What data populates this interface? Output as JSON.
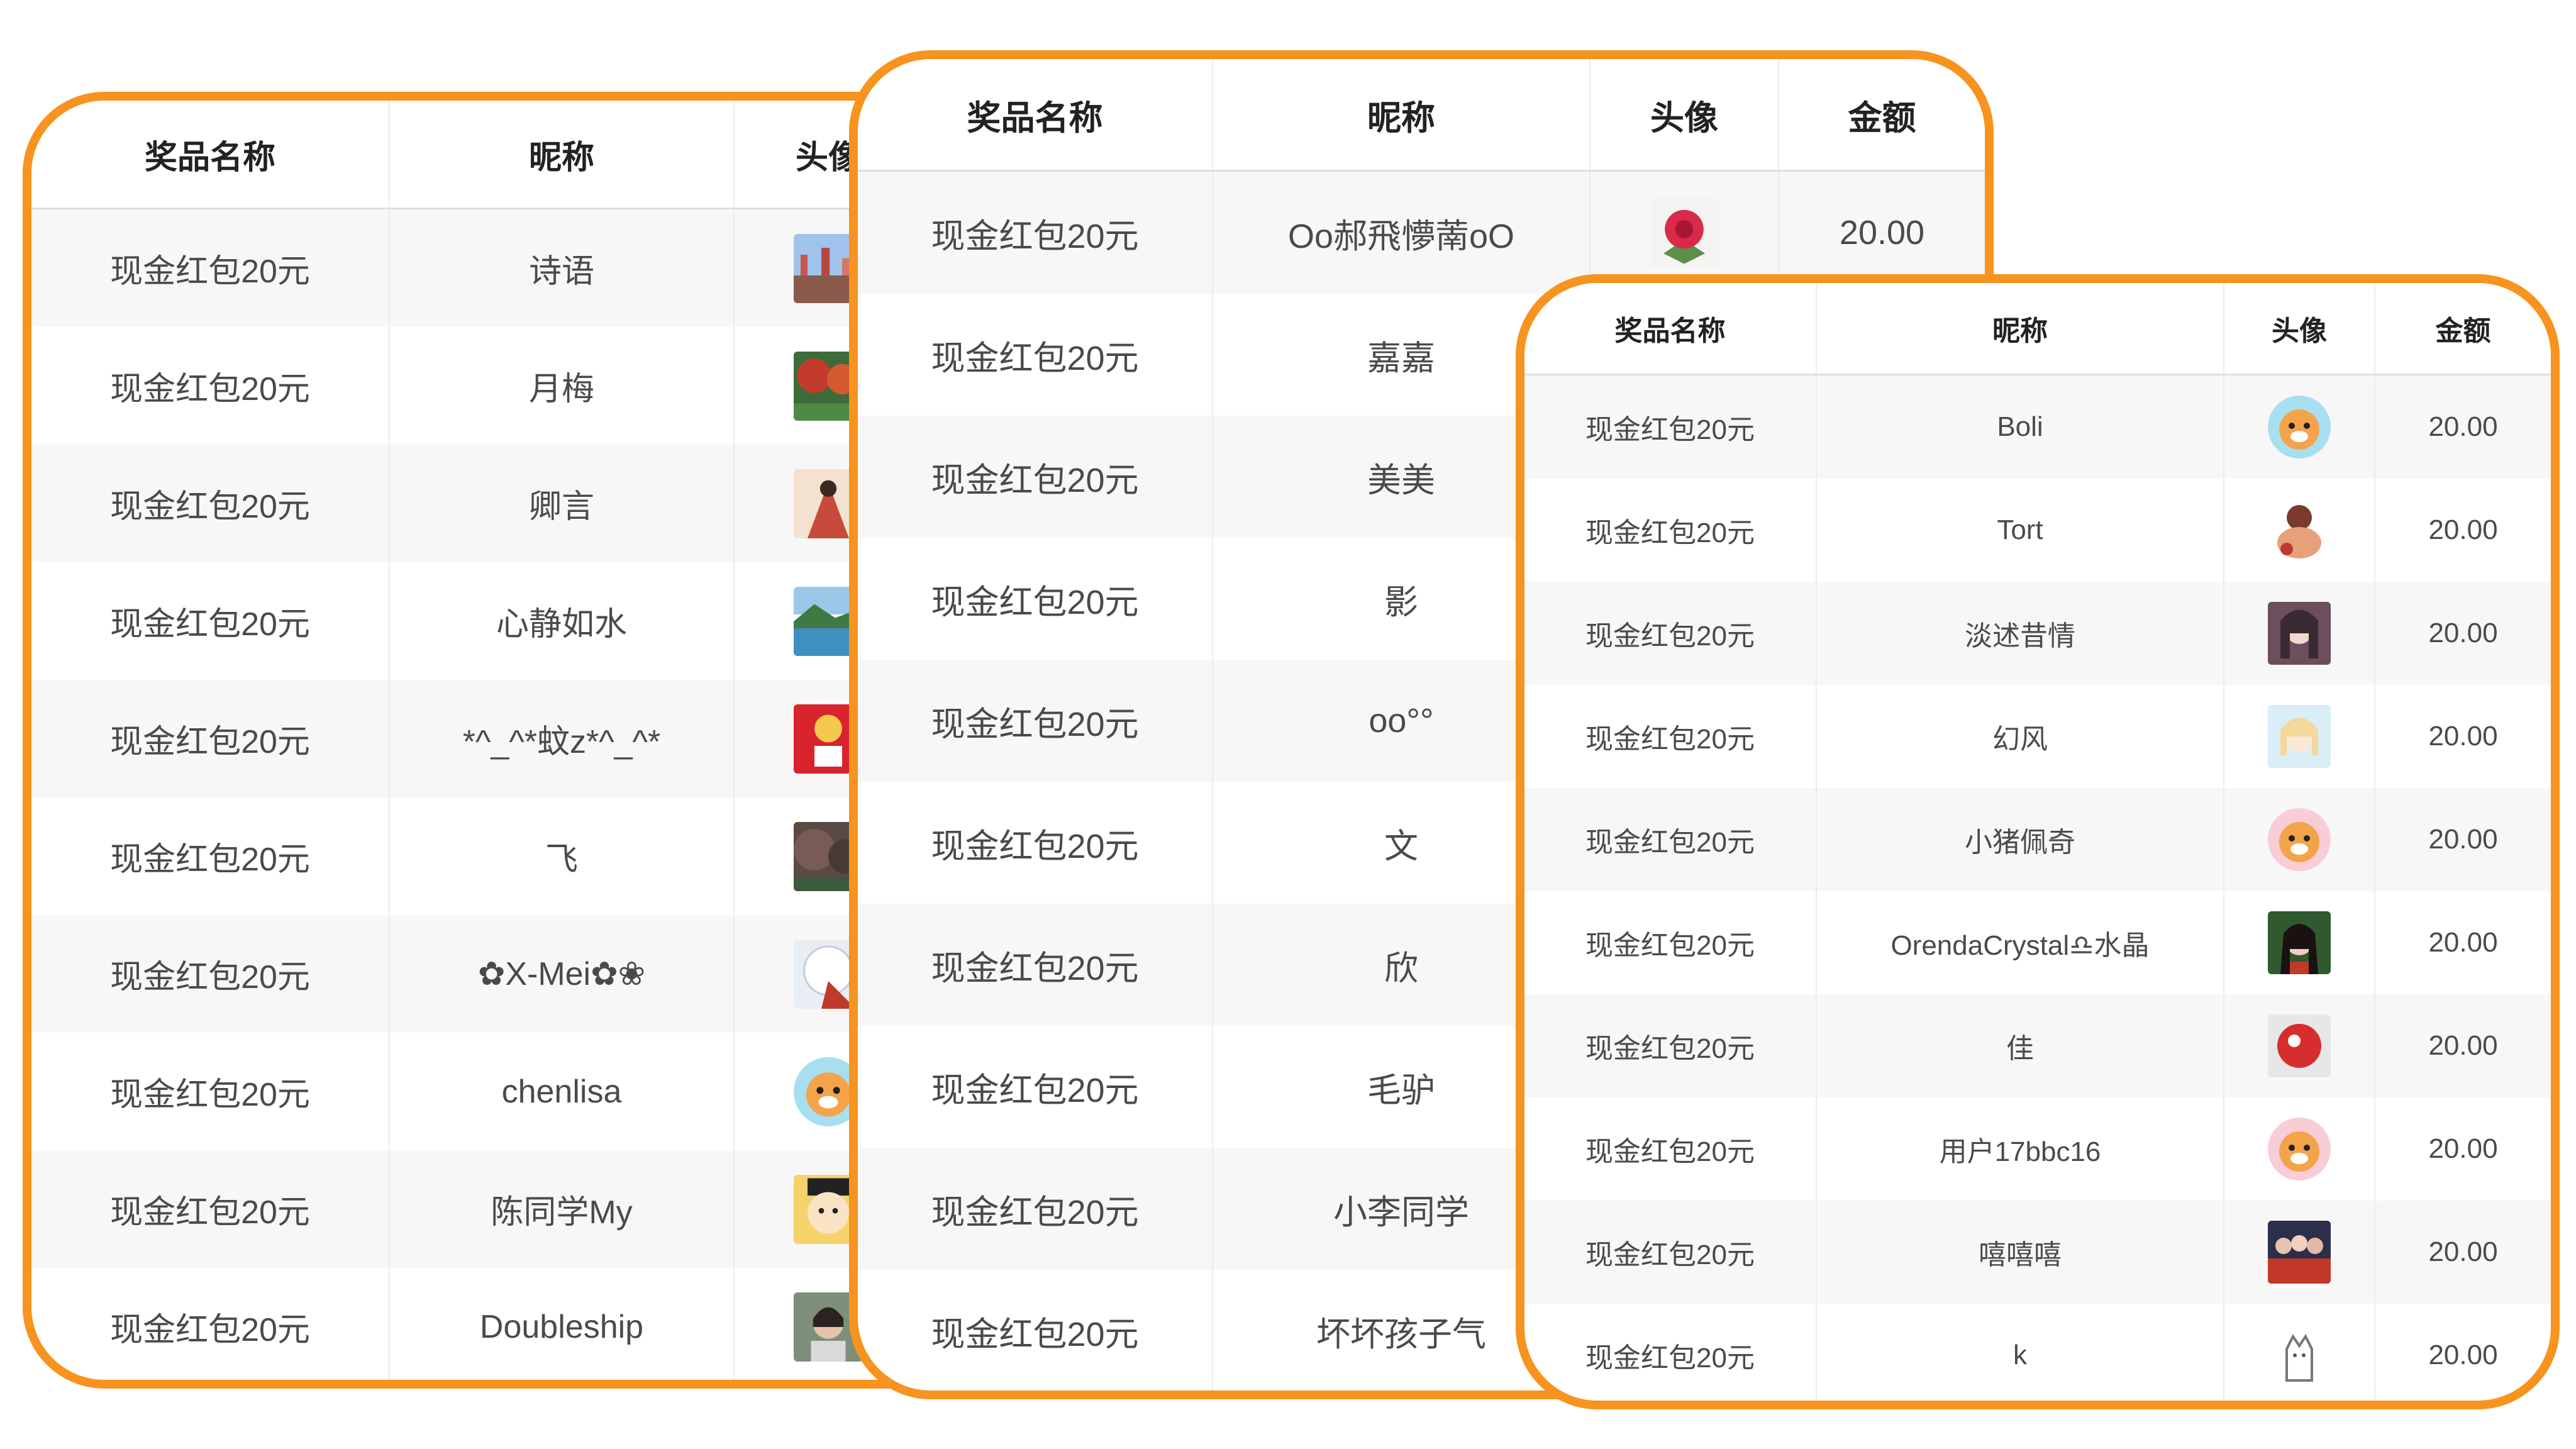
{
  "headers": {
    "prize": "奖品名称",
    "nickname": "昵称",
    "avatar": "头像",
    "amount": "金额"
  },
  "tables": [
    {
      "rows": [
        {
          "prize": "现金红包20元",
          "nickname": "诗语",
          "avatar": "cityscape-photo-icon"
        },
        {
          "prize": "现金红包20元",
          "nickname": "月梅",
          "avatar": "red-trees-photo-icon"
        },
        {
          "prize": "现金红包20元",
          "nickname": "卿言",
          "avatar": "illustrated-figure-icon"
        },
        {
          "prize": "现金红包20元",
          "nickname": "心静如水",
          "avatar": "lake-landscape-photo-icon"
        },
        {
          "prize": "现金红包20元",
          "nickname": "*^_^*蚊z*^_^*",
          "avatar": "red-festive-icon"
        },
        {
          "prize": "现金红包20元",
          "nickname": "飞",
          "avatar": "forest-photo-icon"
        },
        {
          "prize": "现金红包20元",
          "nickname": "✿X-Mei✿❀",
          "avatar": "white-hair-girl-icon"
        },
        {
          "prize": "现金红包20元",
          "nickname": "chenlisa",
          "avatar": "hamster-cartoon-icon"
        },
        {
          "prize": "现金红包20元",
          "nickname": "陈同学My",
          "avatar": "cartoon-boy-icon"
        },
        {
          "prize": "现金红包20元",
          "nickname": "Doubleship",
          "avatar": "person-portrait-icon"
        }
      ]
    },
    {
      "rows": [
        {
          "prize": "现金红包20元",
          "nickname": "Oo郝飛懜萳oO",
          "avatar": "rose-flower-icon",
          "amount": "20.00"
        },
        {
          "prize": "现金红包20元",
          "nickname": "嘉嘉"
        },
        {
          "prize": "现金红包20元",
          "nickname": "美美"
        },
        {
          "prize": "现金红包20元",
          "nickname": "影"
        },
        {
          "prize": "现金红包20元",
          "nickname": "oo°°"
        },
        {
          "prize": "现金红包20元",
          "nickname": "文"
        },
        {
          "prize": "现金红包20元",
          "nickname": "欣"
        },
        {
          "prize": "现金红包20元",
          "nickname": "毛驴"
        },
        {
          "prize": "现金红包20元",
          "nickname": "小李同学"
        },
        {
          "prize": "现金红包20元",
          "nickname": "坏坏孩子气"
        }
      ]
    },
    {
      "rows": [
        {
          "prize": "现金红包20元",
          "nickname": "Boli",
          "avatar": "hamster-cartoon-icon",
          "amount": "20.00"
        },
        {
          "prize": "现金红包20元",
          "nickname": "Tort",
          "avatar": "cartoon-character-icon",
          "amount": "20.00"
        },
        {
          "prize": "现金红包20元",
          "nickname": "淡述昔情",
          "avatar": "anime-girl-icon",
          "amount": "20.00"
        },
        {
          "prize": "现金红包20元",
          "nickname": "幻风",
          "avatar": "anime-girl-light-icon",
          "amount": "20.00"
        },
        {
          "prize": "现金红包20元",
          "nickname": "小猪佩奇",
          "avatar": "hamster-cartoon-pink-icon",
          "amount": "20.00"
        },
        {
          "prize": "现金红包20元",
          "nickname": "OrendaCrystal♎水晶",
          "avatar": "dark-hair-girl-icon",
          "amount": "20.00"
        },
        {
          "prize": "现金红包20元",
          "nickname": "佳",
          "avatar": "red-ball-icon",
          "amount": "20.00"
        },
        {
          "prize": "现金红包20元",
          "nickname": "用户17bbc16",
          "avatar": "hamster-cartoon-pink-icon",
          "amount": "20.00"
        },
        {
          "prize": "现金红包20元",
          "nickname": "嘻嘻嘻",
          "avatar": "group-photo-icon",
          "amount": "20.00"
        },
        {
          "prize": "现金红包20元",
          "nickname": "k",
          "avatar": "cat-sketch-icon",
          "amount": "20.00"
        }
      ]
    }
  ],
  "colors": {
    "border_accent": "#f7931e",
    "row_alt": "#f7f7f7",
    "header_text": "#222222",
    "cell_text": "#4a4a4a"
  }
}
